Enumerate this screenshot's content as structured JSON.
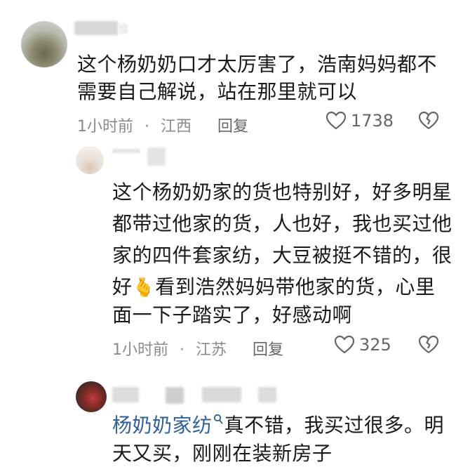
{
  "comments": [
    {
      "lines": [
        "这个杨奶奶口才太厉害了，浩南妈妈都不",
        "需要自己解说，站在那里就可以"
      ],
      "time": "1小时前",
      "dot": "·",
      "location": "江西",
      "reply": "回复",
      "likes": "1738"
    },
    {
      "lines": [
        "这个杨奶奶家的货也特别好，好多明星",
        "都带过他家的货，人也好，我也买过他",
        "家的四件套家纺，大豆被挺不错的，很"
      ],
      "line4_a": "好",
      "emoji": "🫰",
      "line4_b": "看到浩然妈妈带他家的货，心里",
      "line5": "面一下子踏实了，好感动啊",
      "time": "1小时前",
      "dot": "·",
      "location": "江苏",
      "reply": "回复",
      "likes": "325"
    },
    {
      "link": "杨奶奶家纺",
      "line1_rest": "真不错，我买过很多。明",
      "line2": "天又买，刚刚在装新房子"
    }
  ],
  "icons": {
    "like": "heart-outline-icon",
    "dislike": "broken-heart-icon",
    "link": "search-icon"
  },
  "colors": {
    "text": "#1a1a1a",
    "meta": "#8a8a8a",
    "link": "#2f5f9c"
  }
}
